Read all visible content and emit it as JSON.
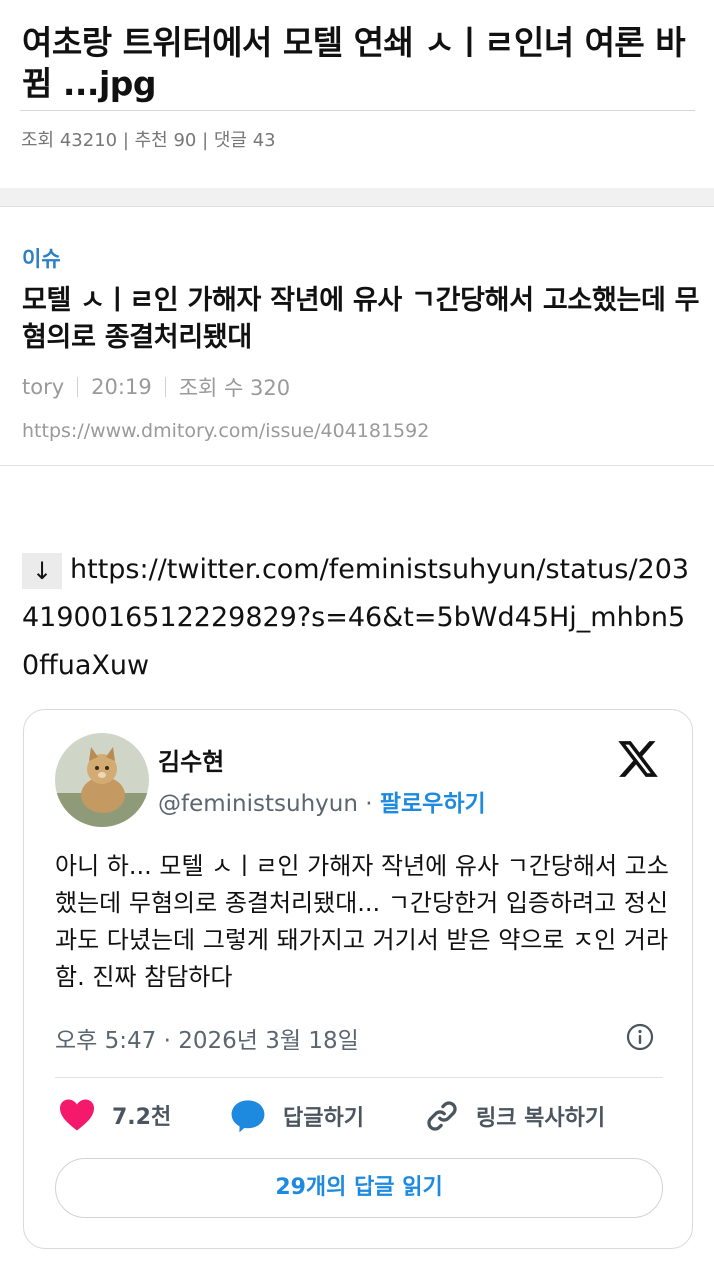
{
  "post": {
    "title": "여초랑 트위터에서 모텔 연쇄 ㅅㅣㄹ인녀 여론 바뀜 ...jpg",
    "stats": "조회 43210 | 추천 90 | 댓글 43"
  },
  "article": {
    "category": "이슈",
    "title": "모텔 ㅅㅣㄹ인 가해자 작년에 유사 ㄱ간당해서 고소했는데 무혐의로 종결처리됐대",
    "author": "tory",
    "time": "20:19",
    "views": "조회 수 320",
    "source_url": "https://www.dmitory.com/issue/404181592"
  },
  "link": {
    "arrow": "↓",
    "url": "https://twitter.com/feministsuhyun/status/2034190016512229829?s=46&t=5bWd45Hj_mhbn50ffuaXuw"
  },
  "tweet": {
    "name": "김수현",
    "handle": "@feministsuhyun",
    "dot": " · ",
    "follow": "팔로우하기",
    "text": "아니 하... 모텔 ㅅㅣㄹ인 가해자 작년에 유사 ㄱ간당해서 고소했는데 무혐의로 종결처리됐대... ㄱ간당한거 입증하려고 정신과도 다녔는데 그렇게 돼가지고 거기서 받은 약으로 ㅈ인 거라 함. 진짜 참담하다",
    "timestamp": "오후 5:47 · 2026년 3월 18일",
    "likes": "7.2천",
    "reply": "답글하기",
    "copy_link": "링크 복사하기",
    "read_replies": "29개의 답글 읽기"
  },
  "icons": {
    "heart": "heart-icon",
    "reply": "reply-bubble-icon",
    "link": "link-icon",
    "info": "info-icon",
    "logo": "x-logo-icon"
  },
  "colors": {
    "accent_blue": "#1d8ae0",
    "category_blue": "#2e7fc4",
    "heart_pink": "#f4196b"
  }
}
